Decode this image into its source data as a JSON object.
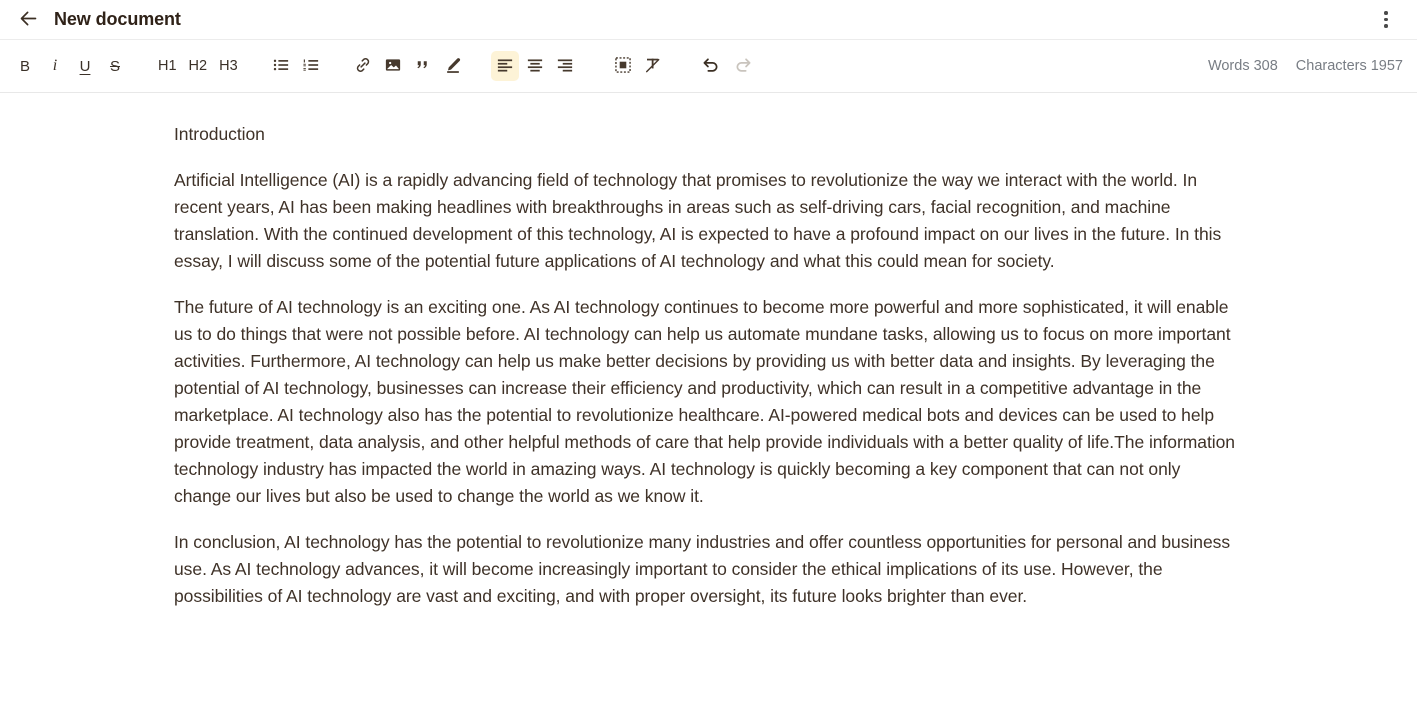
{
  "header": {
    "back_icon": "arrow-left-icon",
    "title": "New document",
    "menu_icon": "kebab-menu-icon"
  },
  "toolbar": {
    "groups": [
      {
        "name": "text-format",
        "items": [
          {
            "name": "bold-button",
            "label": "B",
            "icon": "bold-icon",
            "style": "bold",
            "active": false
          },
          {
            "name": "italic-button",
            "label": "i",
            "icon": "italic-icon",
            "style": "italic",
            "active": false
          },
          {
            "name": "underline-button",
            "label": "U",
            "icon": "underline-icon",
            "style": "underline",
            "active": false
          },
          {
            "name": "strikethrough-button",
            "label": "S",
            "icon": "strikethrough-icon",
            "style": "strike",
            "active": false
          }
        ]
      },
      {
        "name": "headings",
        "items": [
          {
            "name": "heading-1-button",
            "label": "H1",
            "icon": "h1-icon",
            "active": false
          },
          {
            "name": "heading-2-button",
            "label": "H2",
            "icon": "h2-icon",
            "active": false
          },
          {
            "name": "heading-3-button",
            "label": "H3",
            "icon": "h3-icon",
            "active": false
          }
        ]
      },
      {
        "name": "lists",
        "items": [
          {
            "name": "bullet-list-button",
            "label": "",
            "icon": "bullet-list-icon",
            "active": false
          },
          {
            "name": "numbered-list-button",
            "label": "",
            "icon": "numbered-list-icon",
            "active": false
          }
        ]
      },
      {
        "name": "insert",
        "items": [
          {
            "name": "insert-link-button",
            "label": "",
            "icon": "link-icon",
            "active": false
          },
          {
            "name": "insert-image-button",
            "label": "",
            "icon": "image-icon",
            "active": false
          },
          {
            "name": "blockquote-button",
            "label": "",
            "icon": "quote-icon",
            "active": false
          },
          {
            "name": "highlight-button",
            "label": "",
            "icon": "pen-icon",
            "active": false
          }
        ]
      },
      {
        "name": "alignment",
        "items": [
          {
            "name": "align-left-button",
            "label": "",
            "icon": "align-left-icon",
            "active": true
          },
          {
            "name": "align-center-button",
            "label": "",
            "icon": "align-center-icon",
            "active": false
          },
          {
            "name": "align-right-button",
            "label": "",
            "icon": "align-right-icon",
            "active": false
          }
        ]
      },
      {
        "name": "block-tools",
        "items": [
          {
            "name": "insert-block-button",
            "label": "",
            "icon": "dashed-block-icon",
            "active": false
          },
          {
            "name": "clear-formatting-button",
            "label": "",
            "icon": "clear-format-icon",
            "active": false
          }
        ]
      },
      {
        "name": "history",
        "items": [
          {
            "name": "undo-button",
            "label": "",
            "icon": "undo-icon",
            "active": false,
            "disabled": false
          },
          {
            "name": "redo-button",
            "label": "",
            "icon": "redo-icon",
            "active": false,
            "disabled": true
          }
        ]
      }
    ],
    "counts": {
      "words_label": "Words",
      "words_value": "308",
      "characters_label": "Characters",
      "characters_value": "1957",
      "words_text": "Words 308",
      "characters_text": "Characters 1957"
    }
  },
  "document": {
    "paragraphs": [
      "Introduction",
      "Artificial Intelligence (AI) is a rapidly advancing field of technology that promises to revolutionize the way we interact with the world. In recent years, AI has been making headlines with breakthroughs in areas such as self-driving cars, facial recognition, and machine translation. With the continued development of this technology, AI is expected to have a profound impact on our lives in the future. In this essay, I will discuss some of the potential future applications of AI technology and what this could mean for society.",
      "The future of AI technology is an exciting one. As AI technology continues to become more powerful and more sophisticated, it will enable us to do things that were not possible before. AI technology can help us automate mundane tasks, allowing us to focus on more important activities. Furthermore, AI technology can help us make better decisions by providing us with better data and insights. By leveraging the potential of AI technology, businesses can increase their efficiency and productivity, which can result in a competitive advantage in the marketplace. AI technology also has the potential to revolutionize healthcare. AI-powered medical bots and devices can be used to help provide treatment, data analysis, and other helpful methods of care that help provide individuals with a better quality of life.The information technology industry has impacted the world in amazing ways. AI technology is quickly becoming a key component that can not only change our lives but also be used to change the world as we know it.",
      "In conclusion, AI technology has the potential to revolutionize many industries and offer countless opportunities for personal and business use. As AI technology advances, it will become increasingly important to consider the ethical implications of its use. However, the possibilities of AI technology are vast and exciting, and with proper oversight, its future looks brighter than ever."
    ]
  },
  "colors": {
    "accent_active_bg": "#fdf3d7",
    "icon": "#46392d",
    "text": "#3f3228",
    "muted": "#787d84",
    "border": "#ececec",
    "disabled": "#c9c4bd"
  }
}
